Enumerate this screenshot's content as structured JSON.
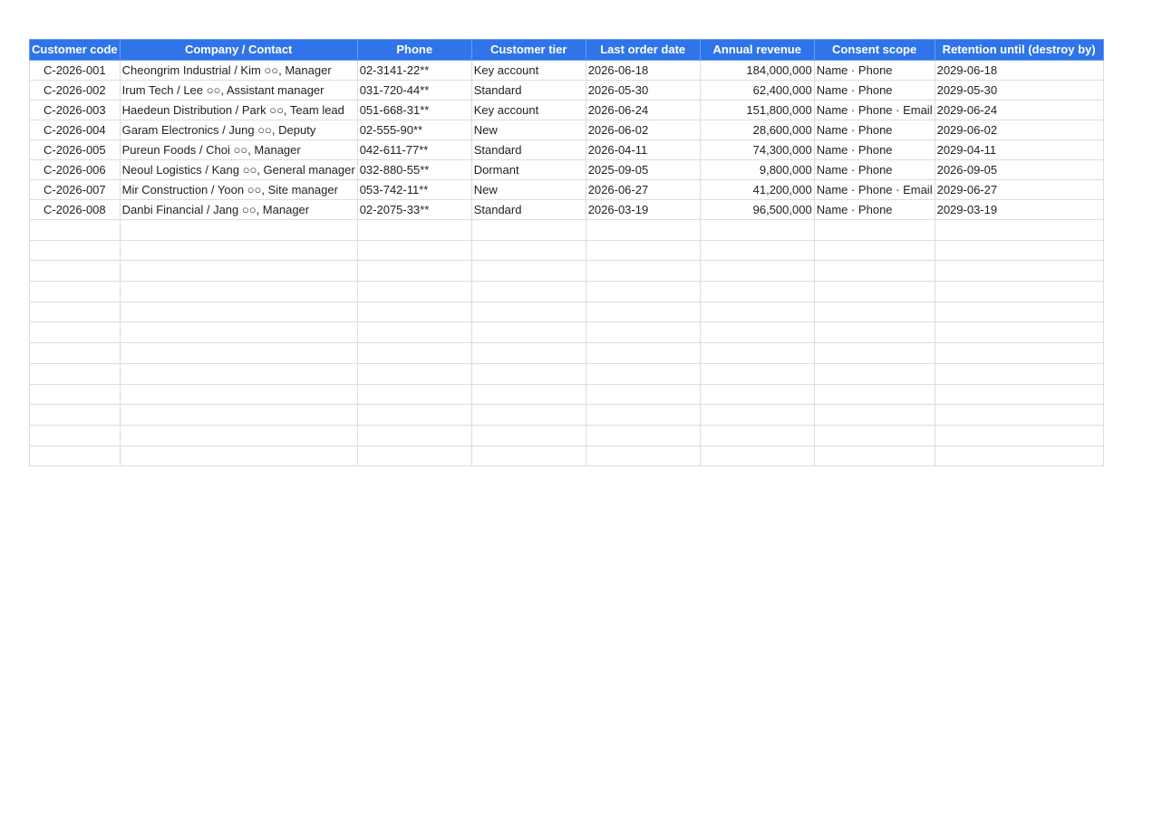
{
  "sheet": {
    "headers": [
      "Customer code",
      "Company / Contact",
      "Phone",
      "Customer tier",
      "Last order date",
      "Annual revenue",
      "Consent scope",
      "Retention until (destroy by)"
    ],
    "rows": [
      [
        "C-2026-001",
        "Cheongrim Industrial / Kim ○○, Manager",
        "02-3141-22**",
        "Key account",
        "2026-06-18",
        "184,000,000",
        "Name · Phone",
        "2029-06-18"
      ],
      [
        "C-2026-002",
        "Irum Tech / Lee ○○, Assistant manager",
        "031-720-44**",
        "Standard",
        "2026-05-30",
        "62,400,000",
        "Name · Phone",
        "2029-05-30"
      ],
      [
        "C-2026-003",
        "Haedeun Distribution / Park ○○, Team lead",
        "051-668-31**",
        "Key account",
        "2026-06-24",
        "151,800,000",
        "Name · Phone · Email",
        "2029-06-24"
      ],
      [
        "C-2026-004",
        "Garam Electronics / Jung ○○, Deputy",
        "02-555-90**",
        "New",
        "2026-06-02",
        "28,600,000",
        "Name · Phone",
        "2029-06-02"
      ],
      [
        "C-2026-005",
        "Pureun Foods / Choi ○○, Manager",
        "042-611-77**",
        "Standard",
        "2026-04-11",
        "74,300,000",
        "Name · Phone",
        "2029-04-11"
      ],
      [
        "C-2026-006",
        "Neoul Logistics / Kang ○○, General manager",
        "032-880-55**",
        "Dormant",
        "2025-09-05",
        "9,800,000",
        "Name · Phone",
        "2026-09-05"
      ],
      [
        "C-2026-007",
        "Mir Construction / Yoon ○○, Site manager",
        "053-742-11**",
        "New",
        "2026-06-27",
        "41,200,000",
        "Name · Phone · Email",
        "2029-06-27"
      ],
      [
        "C-2026-008",
        "Danbi Financial / Jang ○○, Manager",
        "02-2075-33**",
        "Standard",
        "2026-03-19",
        "96,500,000",
        "Name · Phone",
        "2029-03-19"
      ]
    ],
    "empty_rows": 12,
    "colors": {
      "header_bg": "#2f74e8",
      "header_text": "#ffffff",
      "grid": "#d9dde5"
    }
  }
}
